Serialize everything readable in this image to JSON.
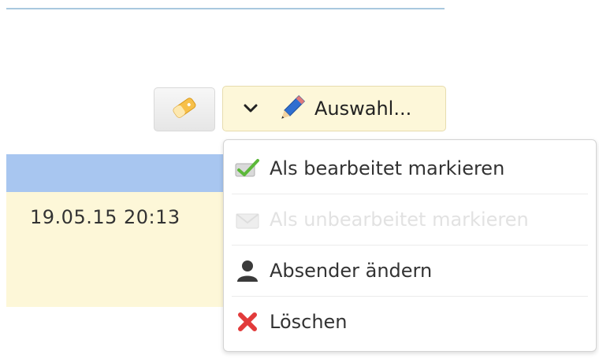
{
  "toolbar": {
    "auswahl_label": "Auswahl..."
  },
  "table": {
    "row_date": "19.05.15 20:13"
  },
  "menu": {
    "items": [
      {
        "label": "Als bearbeitet markieren",
        "icon": "checkmark-icon",
        "enabled": true
      },
      {
        "label": "Als unbearbeitet markieren",
        "icon": "envelope-icon",
        "enabled": false
      },
      {
        "label": "Absender ändern",
        "icon": "user-icon",
        "enabled": true
      },
      {
        "label": "Löschen",
        "icon": "delete-x-icon",
        "enabled": true
      }
    ]
  },
  "colors": {
    "header_blue": "#a8c6f0",
    "row_yellow": "#fdf7d8",
    "button_yellow": "#fdf7d9",
    "delete_red": "#e23b3b",
    "check_green": "#5cb83a"
  }
}
